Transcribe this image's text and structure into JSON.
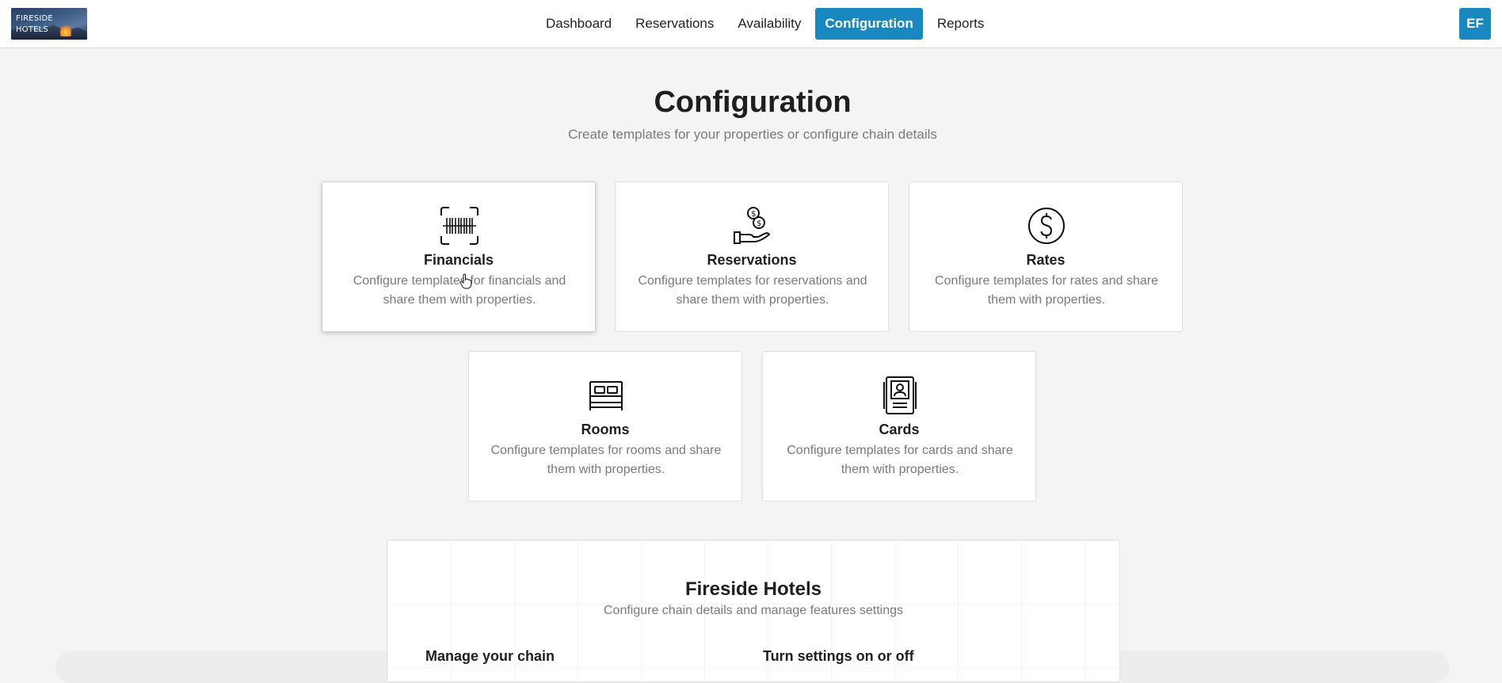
{
  "brand": {
    "line1": "FIRESIDE",
    "line2": "HOTELS"
  },
  "nav": {
    "items": [
      {
        "label": "Dashboard"
      },
      {
        "label": "Reservations"
      },
      {
        "label": "Availability"
      },
      {
        "label": "Configuration",
        "active": true
      },
      {
        "label": "Reports"
      }
    ]
  },
  "user": {
    "initials": "EF"
  },
  "header": {
    "title": "Configuration",
    "subtitle": "Create templates for your properties or configure chain details"
  },
  "cards": [
    {
      "title": "Financials",
      "description": "Configure templates for financials and share them with properties.",
      "icon": "barcode-icon"
    },
    {
      "title": "Reservations",
      "description": "Configure templates for reservations and share them with properties.",
      "icon": "hand-coins-icon"
    },
    {
      "title": "Rates",
      "description": "Configure templates for rates and share them with properties.",
      "icon": "dollar-circle-icon"
    },
    {
      "title": "Rooms",
      "description": "Configure templates for rooms and share them with properties.",
      "icon": "bed-icon"
    },
    {
      "title": "Cards",
      "description": "Configure templates for cards and share them with properties.",
      "icon": "id-card-icon"
    }
  ],
  "chain": {
    "title": "Fireside Hotels",
    "subtitle": "Configure chain details and manage features settings",
    "manage_label": "Manage your chain",
    "settings_label": "Turn settings on or off"
  },
  "colors": {
    "accent": "#1789c0",
    "background": "#f4f4f4"
  }
}
